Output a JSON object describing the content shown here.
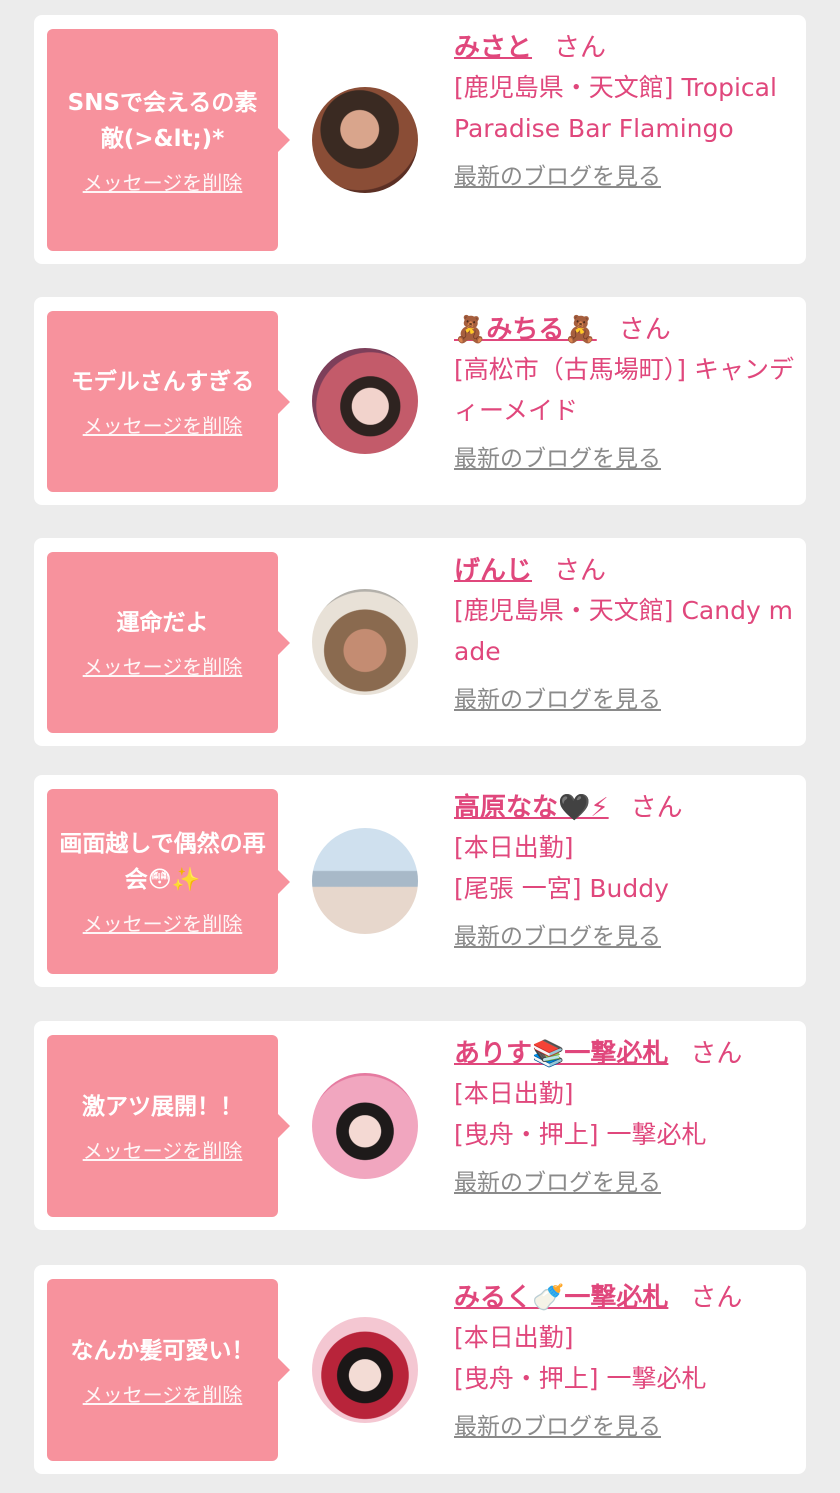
{
  "cards": [
    {
      "message": "SNSで会えるの素敵(>&lt;)*",
      "delete_label": "メッセージを削除",
      "name": "みさと",
      "honorific": "さん",
      "status": "",
      "shop": "[鹿児島県・天文館] Tropical Paradise Bar Flamingo",
      "blog_label": "最新のブログを見る",
      "avatar_icon": "profile-photo"
    },
    {
      "message": "モデルさんすぎる",
      "delete_label": "メッセージを削除",
      "name": "🧸みちる🧸",
      "honorific": "さん",
      "status": "",
      "shop": "[高松市（古馬場町）] キャンディーメイド",
      "blog_label": "最新のブログを見る",
      "avatar_icon": "profile-photo"
    },
    {
      "message": "運命だよ",
      "delete_label": "メッセージを削除",
      "name": "げんじ",
      "honorific": "さん",
      "status": "",
      "shop": "[鹿児島県・天文館] Candy made",
      "blog_label": "最新のブログを見る",
      "avatar_icon": "profile-photo"
    },
    {
      "message": "画面越しで偶然の再会😳✨",
      "delete_label": "メッセージを削除",
      "name": "高原なな🖤⚡",
      "honorific": "さん",
      "status": "[本日出勤]",
      "shop": "[尾張 一宮] Buddy",
      "blog_label": "最新のブログを見る",
      "avatar_icon": "profile-photo"
    },
    {
      "message": "激アツ展開！！",
      "delete_label": "メッセージを削除",
      "name": "ありす📚一撃必札",
      "honorific": "さん",
      "status": "[本日出勤]",
      "shop": "[曳舟・押上] 一撃必札",
      "blog_label": "最新のブログを見る",
      "avatar_icon": "profile-photo"
    },
    {
      "message": "なんか髪可愛い！",
      "delete_label": "メッセージを削除",
      "name": "みるく🍼一撃必札",
      "honorific": "さん",
      "status": "[本日出勤]",
      "shop": "[曳舟・押上] 一撃必札",
      "blog_label": "最新のブログを見る",
      "avatar_icon": "profile-photo"
    }
  ]
}
